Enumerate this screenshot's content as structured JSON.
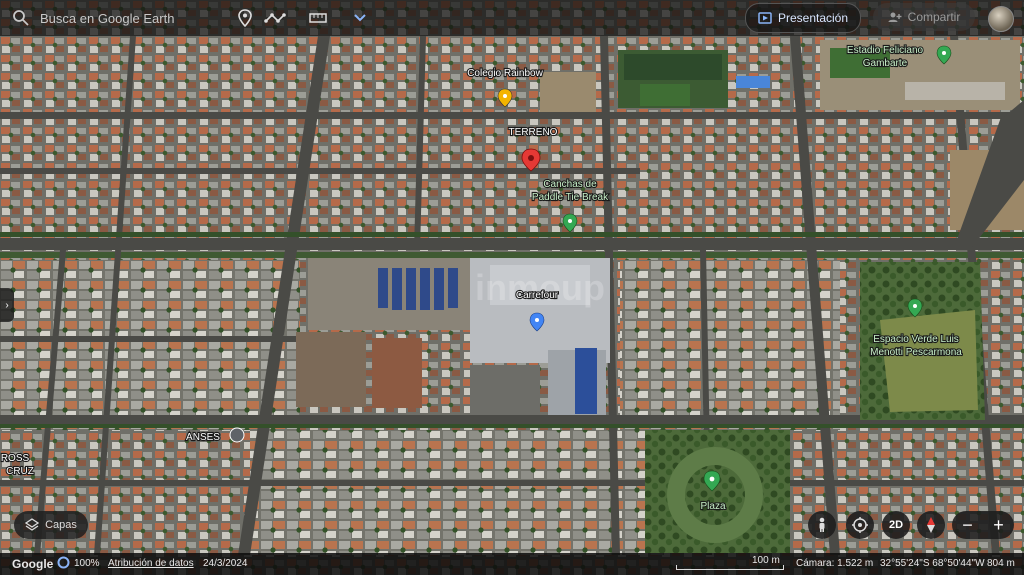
{
  "toolbar": {
    "search_placeholder": "Busca en Google Earth",
    "presentation_label": "Presentación",
    "share_label": "Compartir"
  },
  "places": {
    "colegio": "Colegio Rainbow",
    "terreno": "TERRENO",
    "canchas_line1": "Canchas de",
    "canchas_line2": "Paddle Tie Break",
    "carrefour": "Carrefour",
    "estadio_line1": "Estadio Feliciano",
    "estadio_line2": "Gambarte",
    "espacio_line1": "Espacio Verde Luis",
    "espacio_line2": "Menotti Pescarmona",
    "anses": "ANSES",
    "cross_line1": "ROSS",
    "cross_line2": "CRUZ",
    "plaza": "Plaza",
    "watermark": "inmoup"
  },
  "controls": {
    "layers_label": "Capas",
    "view_2d": "2D"
  },
  "status": {
    "logo": "Google",
    "percent": "100%",
    "attribution": "Atribución de datos",
    "date": "24/3/2024",
    "scale": "100 m",
    "camera": "Cámara: 1.522 m",
    "coords": "32°55'24\"S 68°50'44\"W",
    "elevation": "804 m"
  },
  "colors": {
    "accent": "#8ab4f8",
    "pin_red": "#e53935",
    "pin_yellow": "#f4b400",
    "pin_green": "#34a853",
    "pin_blue": "#4285f4"
  }
}
